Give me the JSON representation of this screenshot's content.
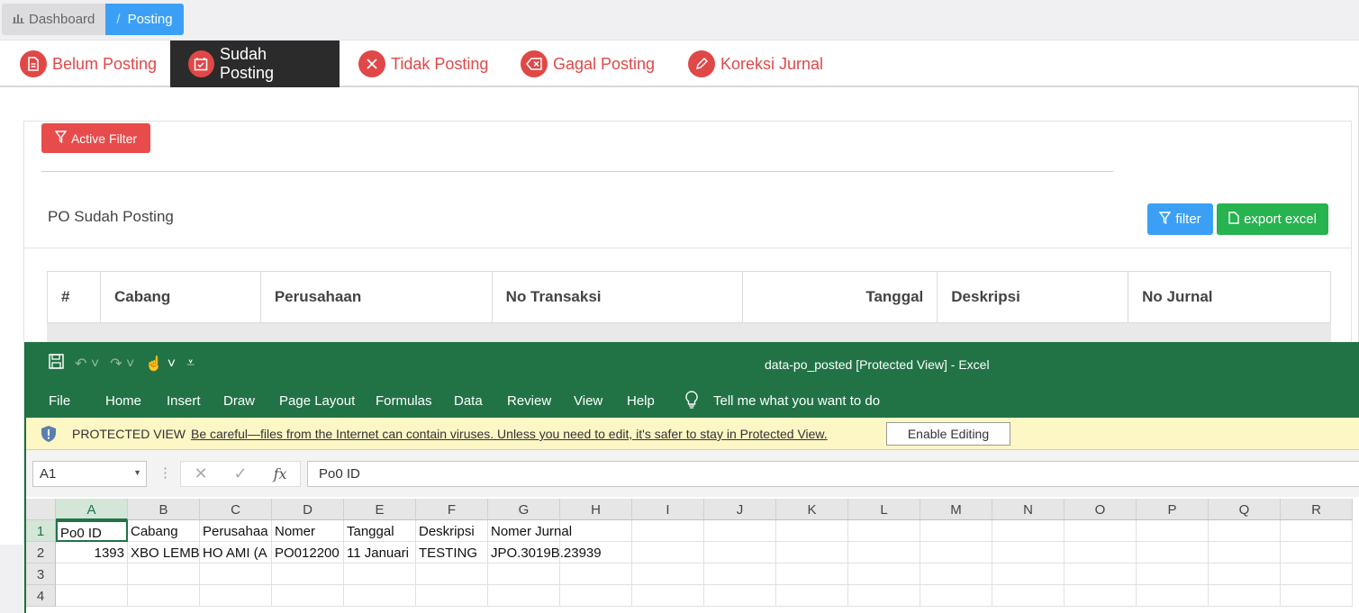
{
  "breadcrumb": {
    "dashboard": "Dashboard",
    "separator": "/",
    "current": "Posting"
  },
  "tabs": [
    {
      "label": "Belum Posting",
      "icon": "document-icon"
    },
    {
      "label": "Sudah Posting",
      "icon": "calendar-check-icon"
    },
    {
      "label": "Tidak Posting",
      "icon": "close-icon"
    },
    {
      "label": "Gagal Posting",
      "icon": "backspace-icon"
    },
    {
      "label": "Koreksi Jurnal",
      "icon": "pencil-icon"
    }
  ],
  "card": {
    "active_filter": "Active Filter",
    "title": "PO Sudah Posting",
    "filter_button": "filter",
    "export_button": "export excel"
  },
  "table": {
    "headers": [
      "#",
      "Cabang",
      "Perusahaan",
      "No Transaksi",
      "Tanggal",
      "Deskripsi",
      "No Jurnal"
    ]
  },
  "excel": {
    "doc_title": "data-po_posted  [Protected View]  -  Excel",
    "ribbon": [
      "File",
      "Home",
      "Insert",
      "Draw",
      "Page Layout",
      "Formulas",
      "Data",
      "Review",
      "View",
      "Help",
      "Tell me what you want to do"
    ],
    "protected_label": "PROTECTED VIEW",
    "protected_msg": "Be careful—files from the Internet can contain viruses. Unless you need to edit, it's safer to stay in Protected View.",
    "enable_button": "Enable Editing",
    "namebox": "A1",
    "formula": "Po0 ID",
    "columns": [
      "A",
      "B",
      "C",
      "D",
      "E",
      "F",
      "G",
      "H",
      "I",
      "J",
      "K",
      "L",
      "M",
      "N",
      "O",
      "P",
      "Q",
      "R"
    ],
    "rows": [
      "1",
      "2",
      "3",
      "4"
    ],
    "row1": [
      "Po0 ID",
      "Cabang",
      "Perusahaa",
      "Nomer",
      "Tanggal",
      "Deskripsi",
      "Nomer Jurnal"
    ],
    "row2": [
      "1393",
      "XBO LEMB",
      "HO AMI (A",
      "PO012200",
      "11 Januari",
      "TESTING",
      "JPO.3019B.23939"
    ]
  },
  "colors": {
    "red": "#e04848",
    "blue": "#3ba0f5",
    "green": "#27b34f",
    "excel_green": "#217346"
  }
}
